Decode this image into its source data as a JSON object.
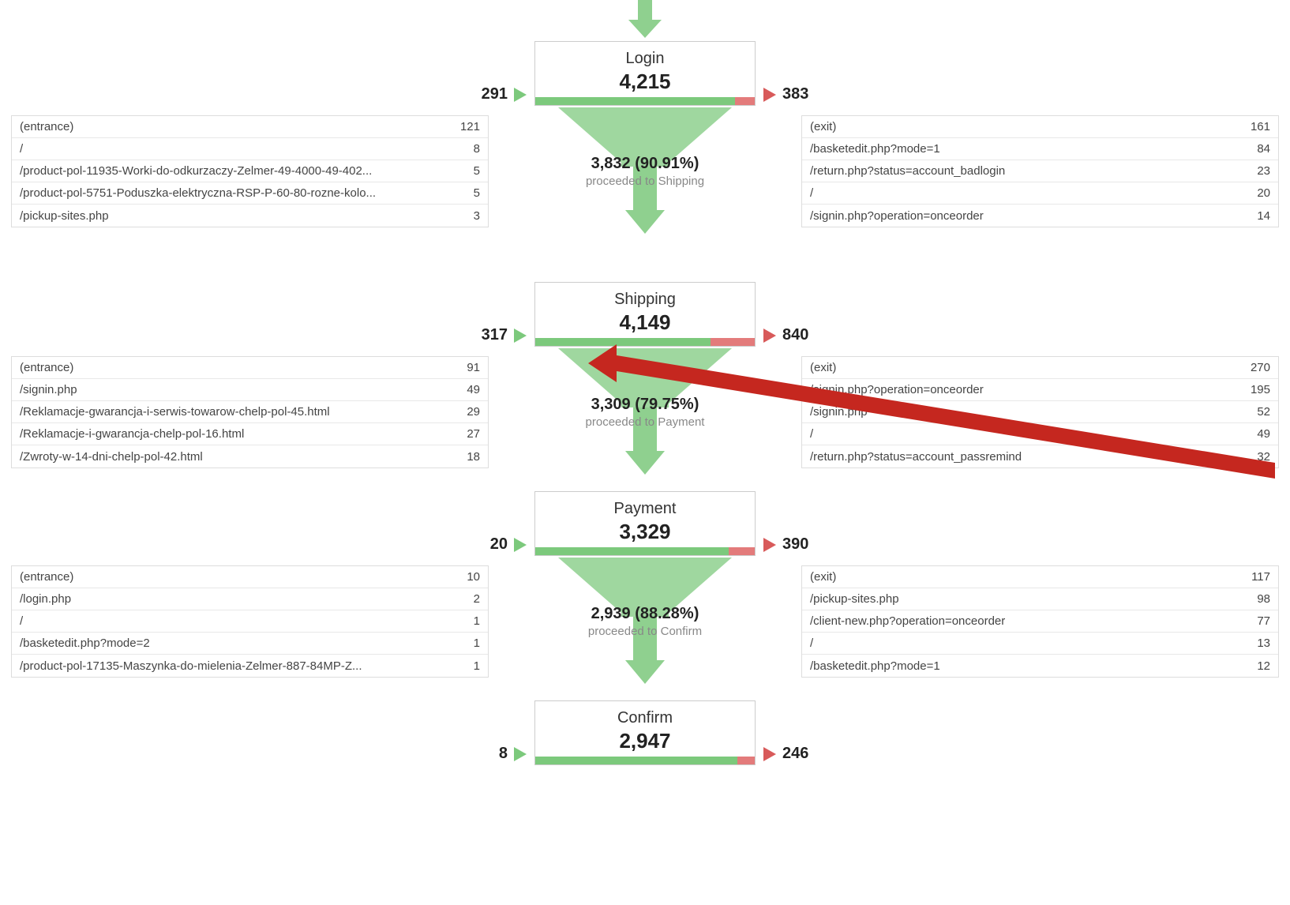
{
  "steps": [
    {
      "title": "Login",
      "count": "4,215",
      "in": "291",
      "out": "383",
      "bar_green_pct": 91,
      "proceed_num": "3,832 (90.91%)",
      "proceed_label": "proceeded to Shipping",
      "left_rows": [
        {
          "path": "(entrance)",
          "val": "121"
        },
        {
          "path": "/",
          "val": "8"
        },
        {
          "path": "/product-pol-11935-Worki-do-odkurzaczy-Zelmer-49-4000-49-402...",
          "val": "5"
        },
        {
          "path": "/product-pol-5751-Poduszka-elektryczna-RSP-P-60-80-rozne-kolo...",
          "val": "5"
        },
        {
          "path": "/pickup-sites.php",
          "val": "3"
        }
      ],
      "right_rows": [
        {
          "path": "(exit)",
          "val": "161"
        },
        {
          "path": "/basketedit.php?mode=1",
          "val": "84"
        },
        {
          "path": "/return.php?status=account_badlogin",
          "val": "23"
        },
        {
          "path": "/",
          "val": "20"
        },
        {
          "path": "/signin.php?operation=onceorder",
          "val": "14"
        }
      ]
    },
    {
      "title": "Shipping",
      "count": "4,149",
      "in": "317",
      "out": "840",
      "bar_green_pct": 80,
      "proceed_num": "3,309 (79.75%)",
      "proceed_label": "proceeded to Payment",
      "left_rows": [
        {
          "path": "(entrance)",
          "val": "91"
        },
        {
          "path": "/signin.php",
          "val": "49"
        },
        {
          "path": "/Reklamacje-gwarancja-i-serwis-towarow-chelp-pol-45.html",
          "val": "29"
        },
        {
          "path": "/Reklamacje-i-gwarancja-chelp-pol-16.html",
          "val": "27"
        },
        {
          "path": "/Zwroty-w-14-dni-chelp-pol-42.html",
          "val": "18"
        }
      ],
      "right_rows": [
        {
          "path": "(exit)",
          "val": "270"
        },
        {
          "path": "/signin.php?operation=onceorder",
          "val": "195"
        },
        {
          "path": "/signin.php",
          "val": "52"
        },
        {
          "path": "/",
          "val": "49"
        },
        {
          "path": "/return.php?status=account_passremind",
          "val": "32"
        }
      ]
    },
    {
      "title": "Payment",
      "count": "3,329",
      "in": "20",
      "out": "390",
      "bar_green_pct": 88,
      "proceed_num": "2,939 (88.28%)",
      "proceed_label": "proceeded to Confirm",
      "left_rows": [
        {
          "path": "(entrance)",
          "val": "10"
        },
        {
          "path": "/login.php",
          "val": "2"
        },
        {
          "path": "/",
          "val": "1"
        },
        {
          "path": "/basketedit.php?mode=2",
          "val": "1"
        },
        {
          "path": "/product-pol-17135-Maszynka-do-mielenia-Zelmer-887-84MP-Z...",
          "val": "1"
        }
      ],
      "right_rows": [
        {
          "path": "(exit)",
          "val": "117"
        },
        {
          "path": "/pickup-sites.php",
          "val": "98"
        },
        {
          "path": "/client-new.php?operation=onceorder",
          "val": "77"
        },
        {
          "path": "/",
          "val": "13"
        },
        {
          "path": "/basketedit.php?mode=1",
          "val": "12"
        }
      ]
    },
    {
      "title": "Confirm",
      "count": "2,947",
      "in": "8",
      "out": "246",
      "bar_green_pct": 92,
      "proceed_num": "",
      "proceed_label": "",
      "left_rows": [],
      "right_rows": []
    }
  ]
}
